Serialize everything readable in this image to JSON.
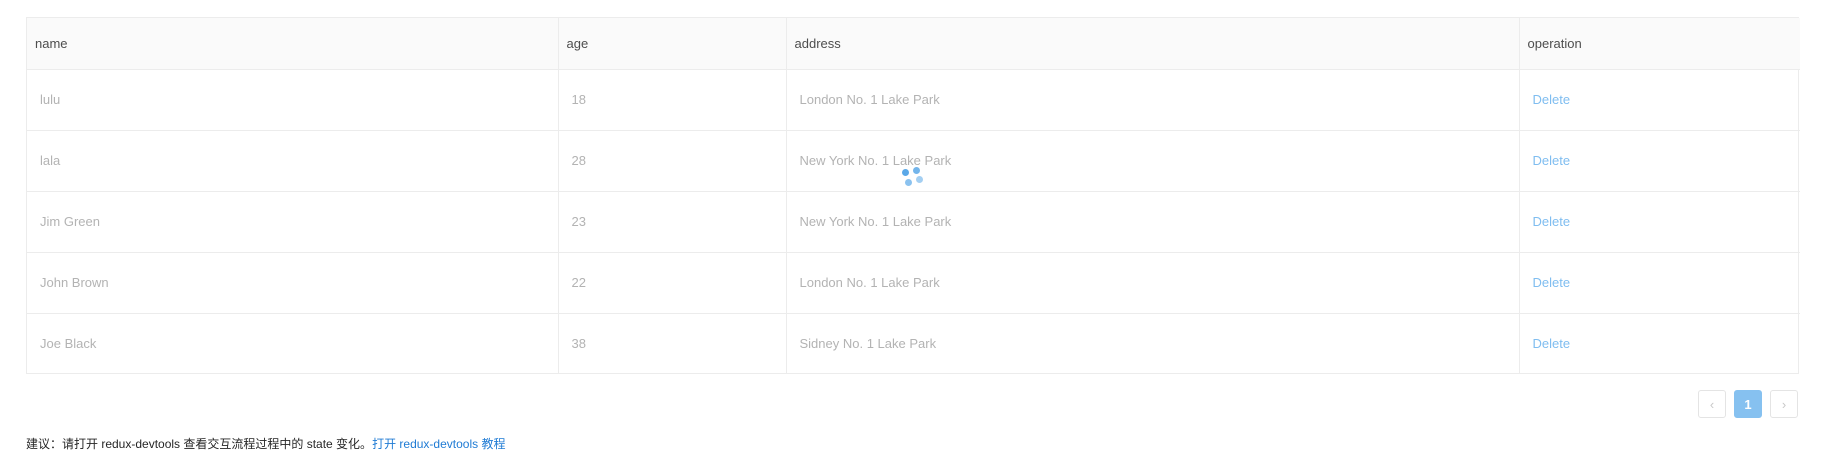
{
  "table": {
    "columns": [
      "name",
      "age",
      "address",
      "operation"
    ],
    "rows": [
      {
        "name": "lulu",
        "age": "18",
        "address": "London No. 1 Lake Park",
        "operation": "Delete"
      },
      {
        "name": "lala",
        "age": "28",
        "address": "New York No. 1 Lake Park",
        "operation": "Delete"
      },
      {
        "name": "Jim Green",
        "age": "23",
        "address": "New York No. 1 Lake Park",
        "operation": "Delete"
      },
      {
        "name": "John Brown",
        "age": "22",
        "address": "London No. 1 Lake Park",
        "operation": "Delete"
      },
      {
        "name": "Joe Black",
        "age": "38",
        "address": "Sidney No. 1 Lake Park",
        "operation": "Delete"
      }
    ]
  },
  "pagination": {
    "prev_icon": "‹",
    "current_page": "1",
    "next_icon": "›"
  },
  "footer": {
    "note": "建议：请打开 redux-devtools 查看交互流程过程中的 state 变化。",
    "link": "打开 redux-devtools 教程"
  },
  "colors": {
    "accent": "#86c1f0",
    "link": "#1f7bd4",
    "spinner": "#5aa8e8"
  }
}
